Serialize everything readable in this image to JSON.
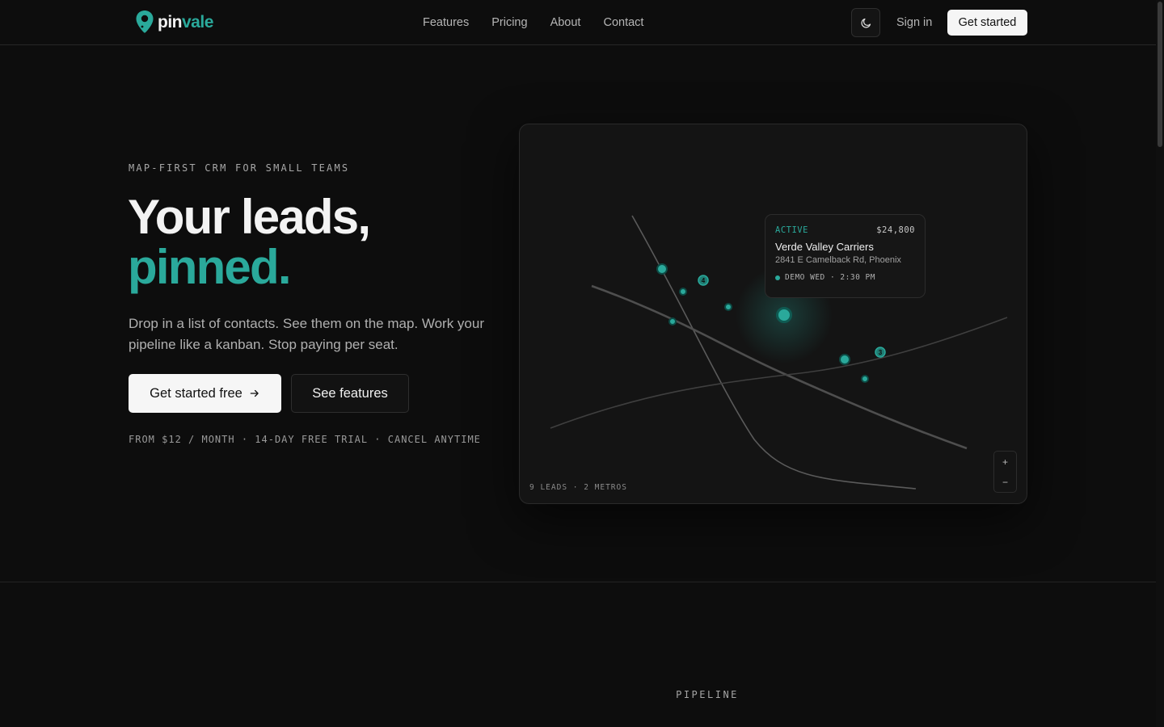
{
  "brand": {
    "name_part1": "pin",
    "name_part2": "vale",
    "accent": "#2aa99b"
  },
  "nav": {
    "items": [
      {
        "label": "Features"
      },
      {
        "label": "Pricing"
      },
      {
        "label": "About"
      },
      {
        "label": "Contact"
      }
    ],
    "theme_icon": "moon-icon",
    "signin_label": "Sign in",
    "cta_label": "Get started"
  },
  "hero": {
    "eyebrow": "MAP-FIRST CRM FOR SMALL TEAMS",
    "headline_line1": "Your leads,",
    "headline_line2": "pinned.",
    "lede": "Drop in a list of contacts. See them on the map. Work your pipeline like a kanban. Stop paying per seat.",
    "primary_cta": "Get started free",
    "primary_cta_icon": "arrow-right-icon",
    "secondary_cta": "See features",
    "fine_print": "FROM $12 / MONTH · 14-DAY FREE TRIAL · CANCEL ANYTIME"
  },
  "map": {
    "popup": {
      "status": "ACTIVE",
      "amount": "$24,800",
      "name": "Verde Valley Carriers",
      "address": "2841 E Camelback Rd, Phoenix",
      "event": "DEMO WED · 2:30 PM"
    },
    "cluster_counts": [
      "4",
      "3"
    ],
    "footer": "9 LEADS · 2 METROS",
    "zoom_in": "+",
    "zoom_out": "−"
  },
  "section": {
    "label": "PIPELINE"
  }
}
